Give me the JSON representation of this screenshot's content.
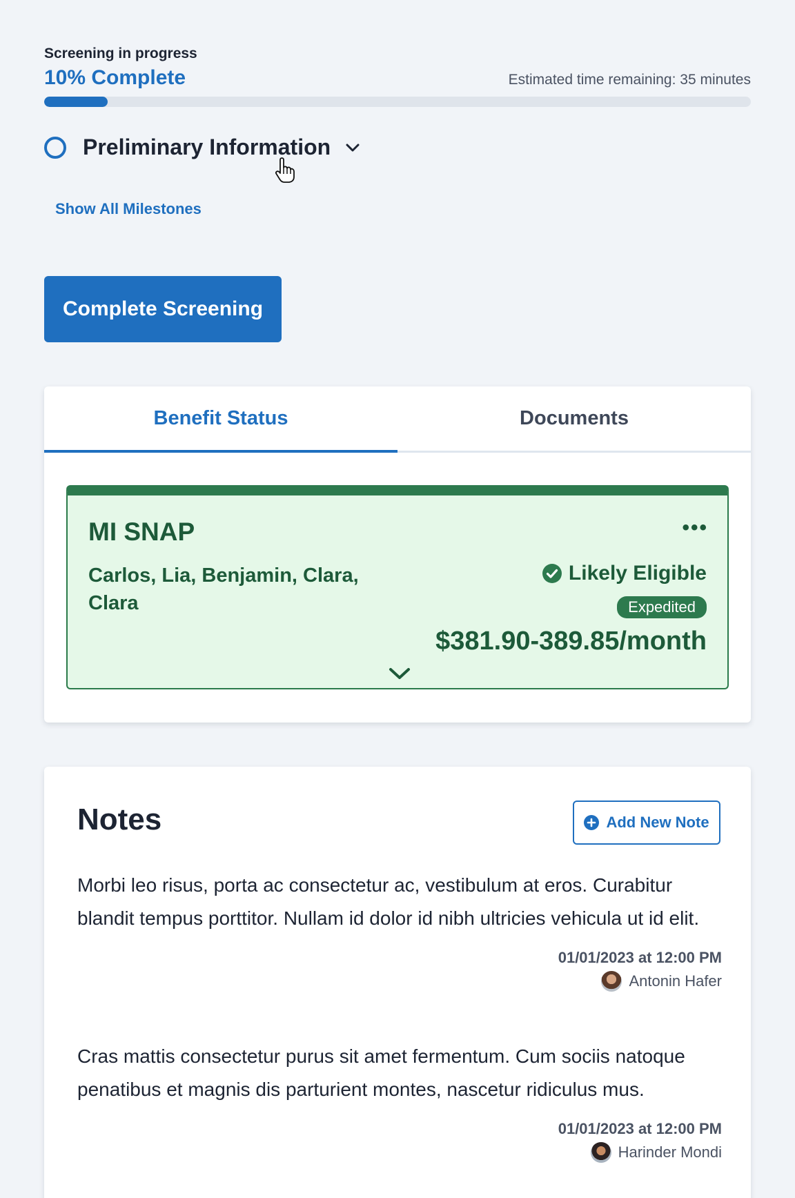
{
  "progress": {
    "label": "Screening in progress",
    "percent_text": "10% Complete",
    "percent": 0.09,
    "eta": "Estimated time remaining: 35 minutes"
  },
  "milestone": {
    "label": "Preliminary Information",
    "show_all": "Show All Milestones"
  },
  "complete_button": "Complete Screening",
  "tabs": [
    {
      "label": "Benefit Status",
      "active": true
    },
    {
      "label": "Documents",
      "active": false
    }
  ],
  "benefit": {
    "title": "MI SNAP",
    "more": "•••",
    "members": "Carlos, Lia, Benjamin, Clara, Clara",
    "status": "Likely Eligible",
    "badge": "Expedited",
    "amount": "$381.90-389.85/month",
    "colors": {
      "header": "#2d7a4e",
      "background": "#e5f8e8",
      "text": "#1d5a39"
    }
  },
  "notes": {
    "title": "Notes",
    "add_button": "Add New Note",
    "items": [
      {
        "body": "Morbi leo risus, porta ac consectetur ac, vestibulum at eros. Curabitur blandit tempus porttitor. Nullam id dolor id nibh ultricies vehicula ut id elit.",
        "date": "01/01/2023 at 12:00 PM",
        "author": "Antonin Hafer"
      },
      {
        "body": "Cras mattis consectetur purus sit amet fermentum. Cum sociis natoque penatibus et magnis dis parturient montes, nascetur ridiculus mus.",
        "date": "01/01/2023 at 12:00 PM",
        "author": "Harinder Mondi"
      }
    ]
  },
  "accent_color": "#1f6fbf"
}
